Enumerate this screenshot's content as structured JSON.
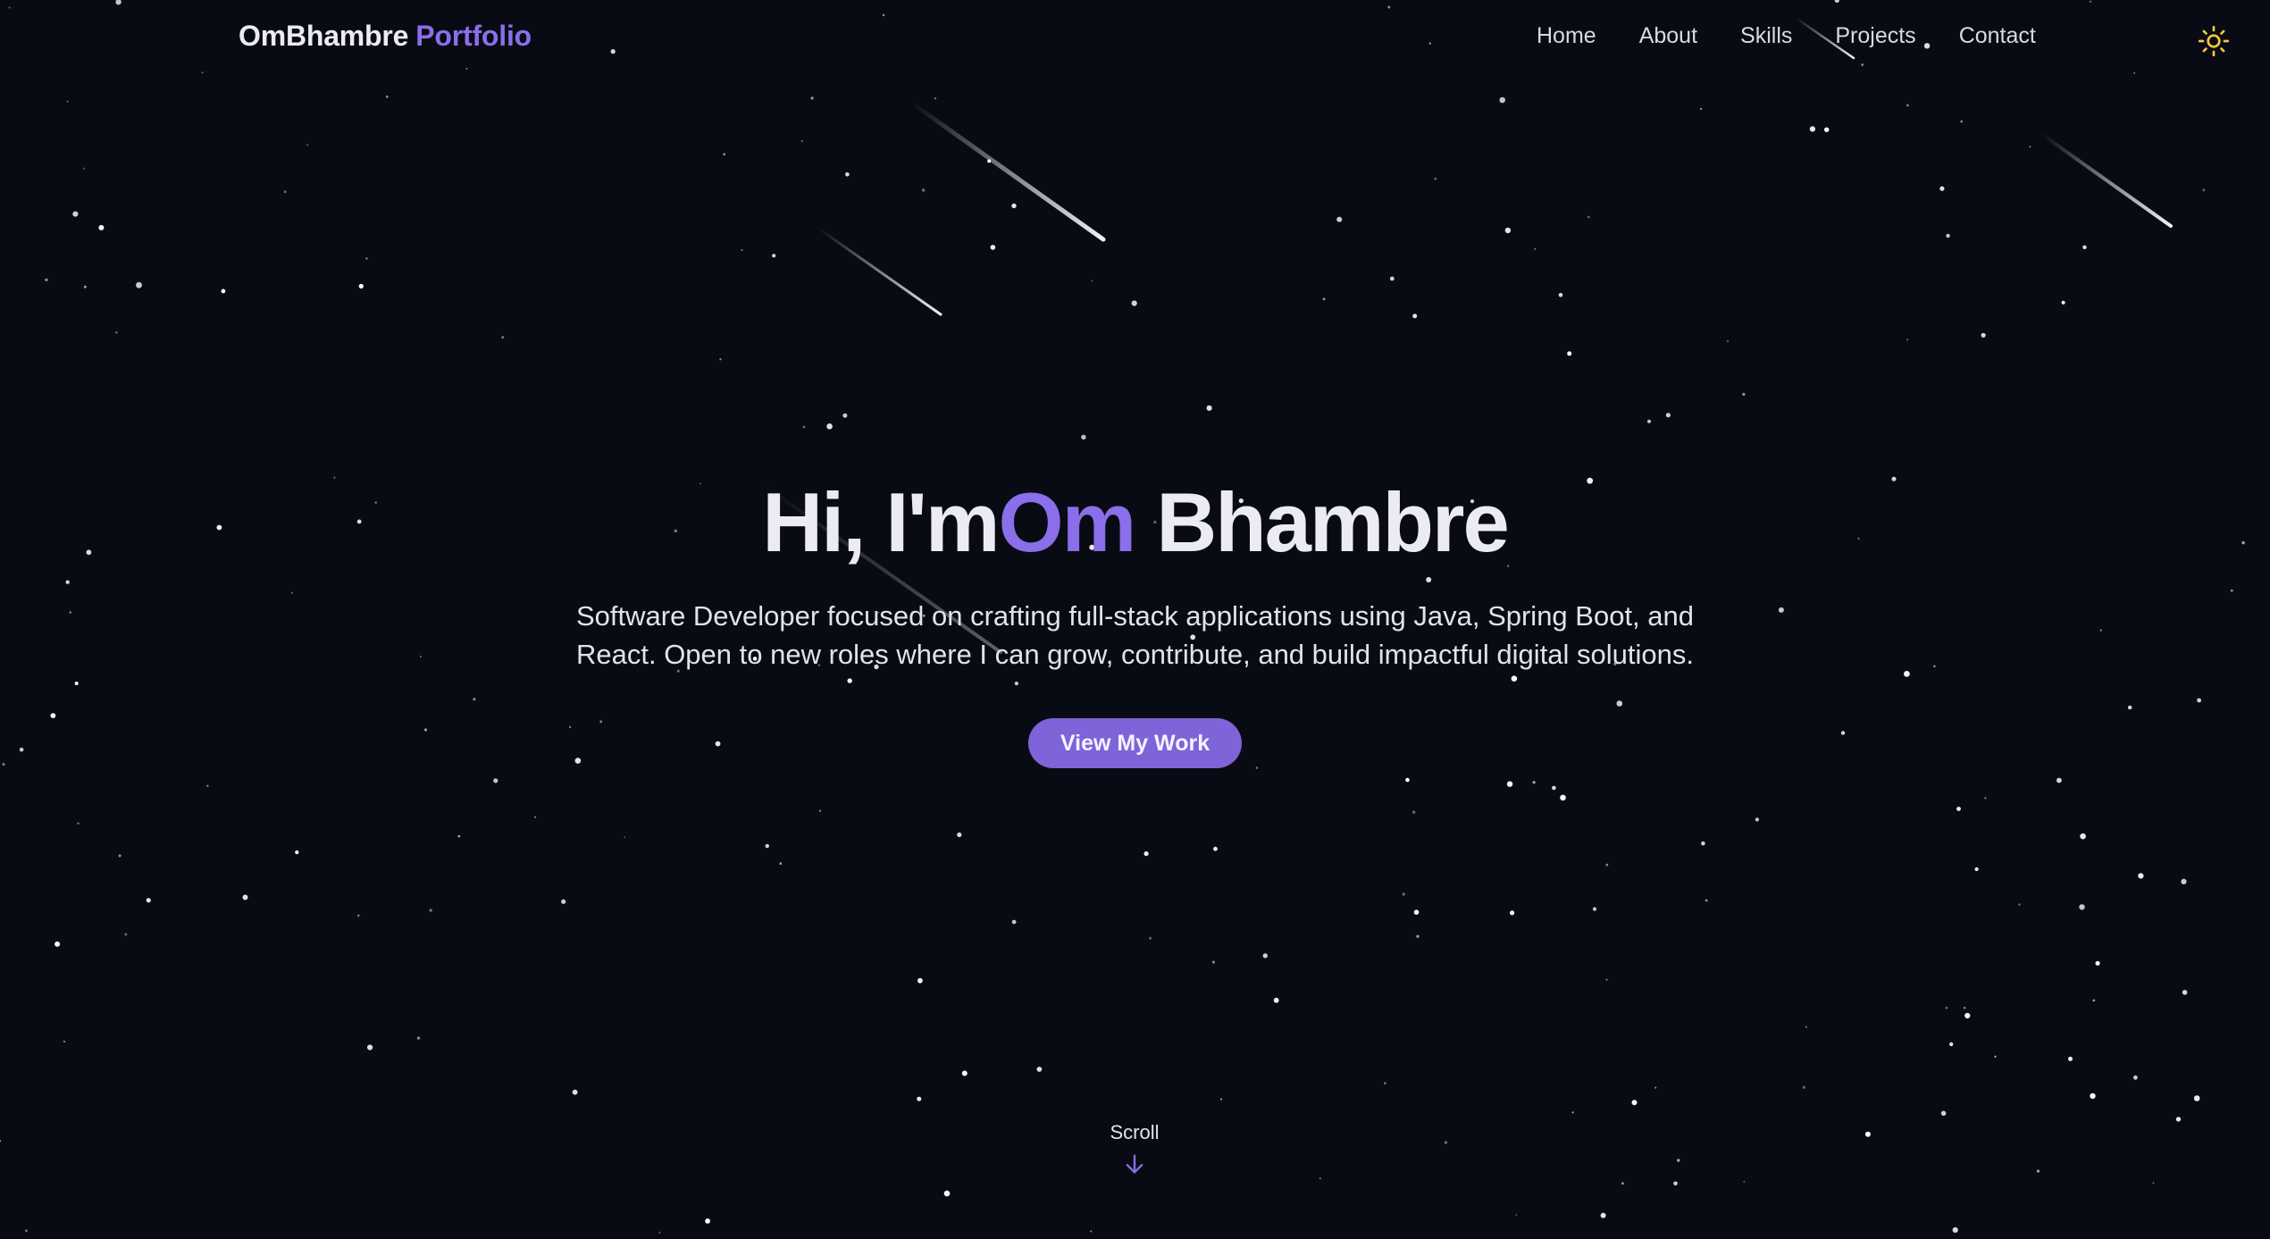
{
  "nav": {
    "brand_name": "OmBhambre",
    "brand_accent": "Portfolio",
    "links": [
      "Home",
      "About",
      "Skills",
      "Projects",
      "Contact"
    ],
    "theme_icon": "sun-icon"
  },
  "hero": {
    "greeting": "Hi, I'm",
    "first_name": "Om",
    "last_name": "Bhambre",
    "subtitle_line1": "Software Developer focused on crafting full-stack applications using Java, Spring Boot, and",
    "subtitle_line2": "React. Open to new roles where I can grow, contribute, and build impactful digital solutions.",
    "cta_label": "View My Work"
  },
  "scroll": {
    "label": "Scroll",
    "icon": "arrow-down-icon"
  },
  "colors": {
    "background": "#090b14",
    "accent": "#8b6ee9",
    "button": "#7f63d8",
    "text": "#eceaf5",
    "sun": "#f5c542"
  }
}
